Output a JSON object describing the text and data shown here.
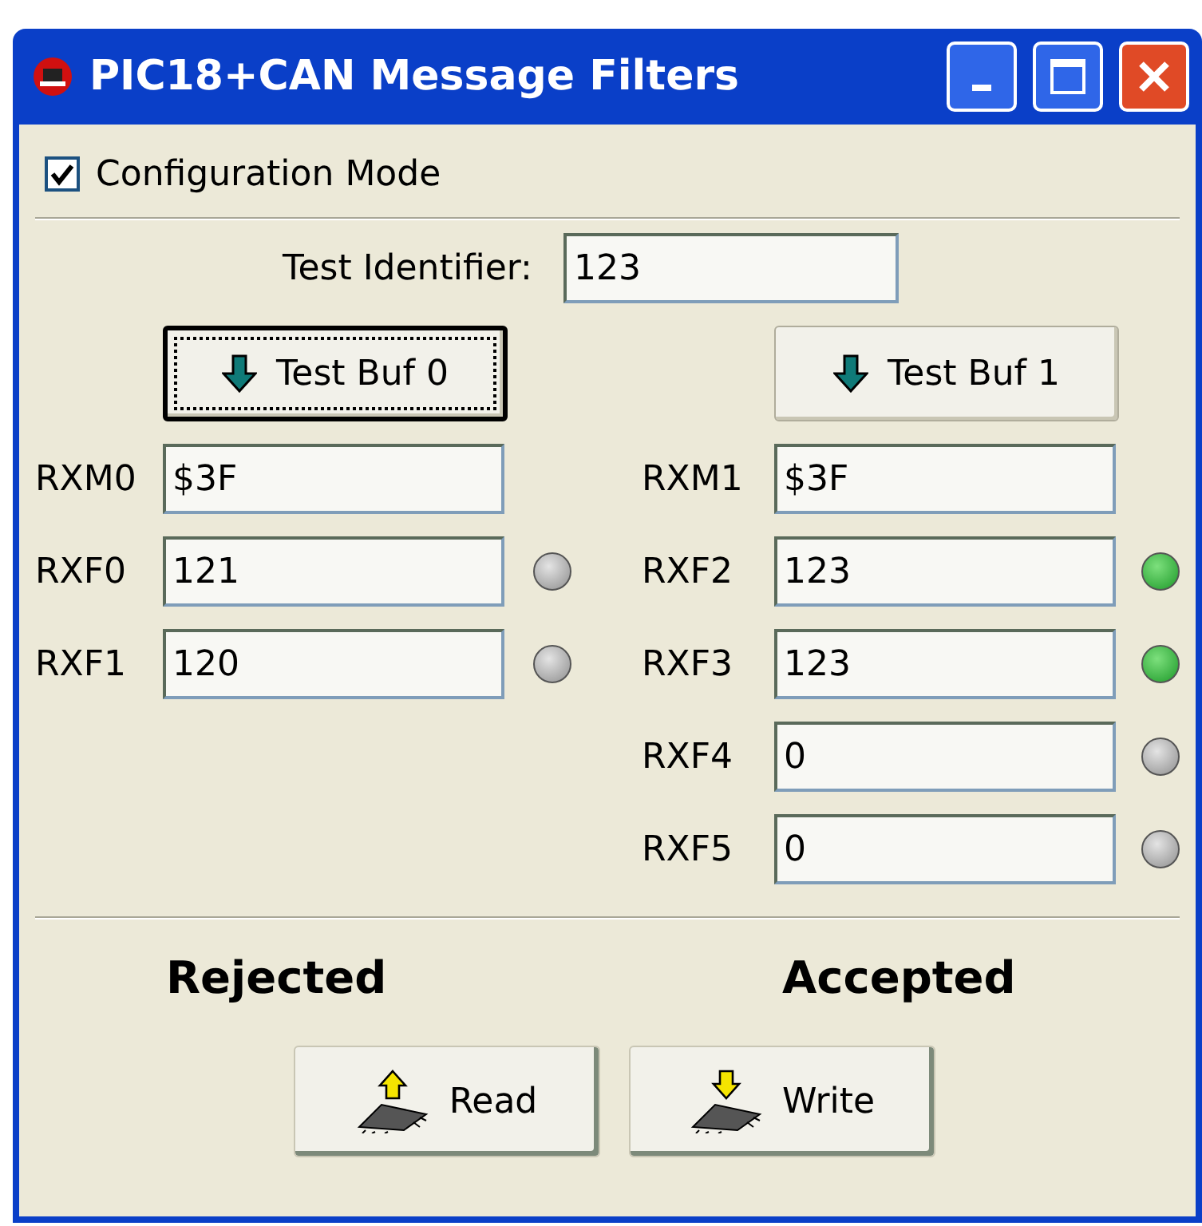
{
  "window": {
    "title": "PIC18+CAN Message Filters"
  },
  "configuration_mode": {
    "label": "Configuration Mode",
    "checked": true
  },
  "test_identifier": {
    "label": "Test Identifier:",
    "value": "123"
  },
  "buffers": [
    {
      "button": {
        "label": "Test Buf 0",
        "focused": true
      },
      "mask": {
        "label": "RXM0",
        "value": "$3F"
      },
      "filters": [
        {
          "label": "RXF0",
          "value": "121",
          "on": false
        },
        {
          "label": "RXF1",
          "value": "120",
          "on": false
        }
      ],
      "result": "Rejected"
    },
    {
      "button": {
        "label": "Test Buf 1",
        "focused": false
      },
      "mask": {
        "label": "RXM1",
        "value": "$3F"
      },
      "filters": [
        {
          "label": "RXF2",
          "value": "123",
          "on": true
        },
        {
          "label": "RXF3",
          "value": "123",
          "on": true
        },
        {
          "label": "RXF4",
          "value": "0",
          "on": false
        },
        {
          "label": "RXF5",
          "value": "0",
          "on": false
        }
      ],
      "result": "Accepted"
    }
  ],
  "buttons": [
    {
      "kind": "read",
      "label": "Read"
    },
    {
      "kind": "write",
      "label": "Write"
    }
  ]
}
